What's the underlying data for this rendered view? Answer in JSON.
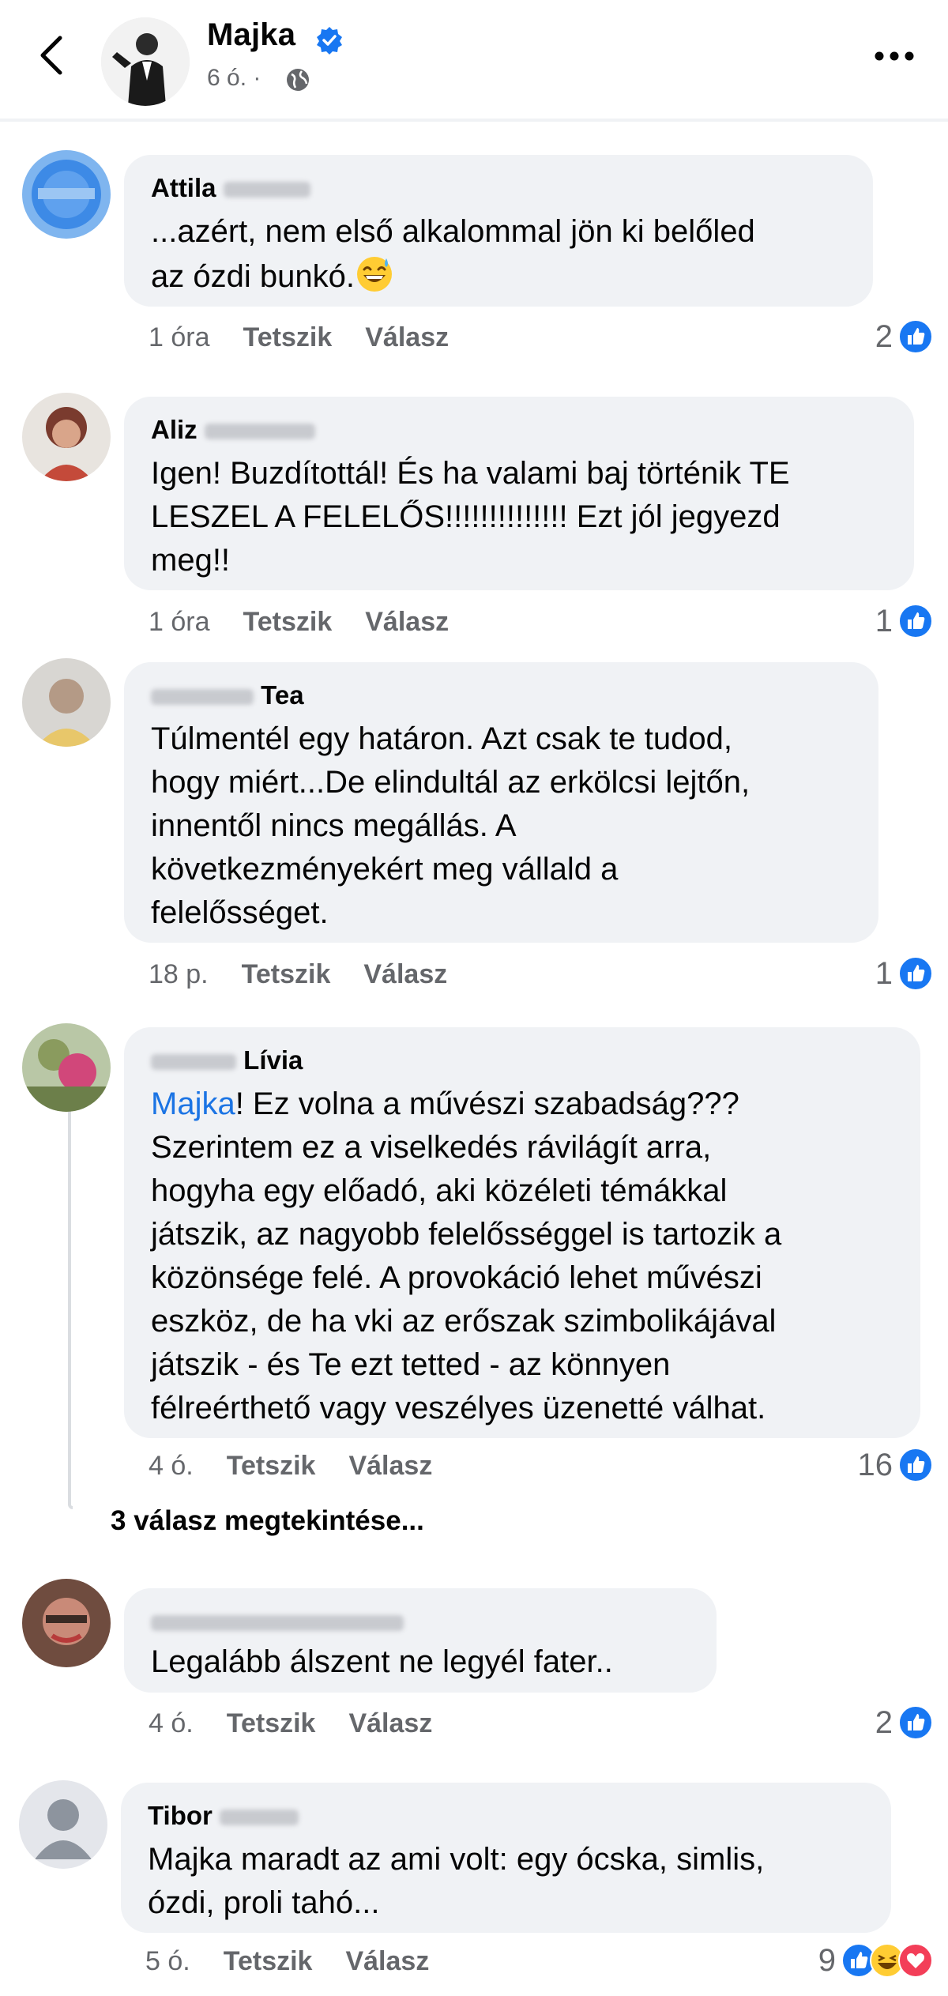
{
  "header": {
    "name": "Majka",
    "time": "6 ó. ·"
  },
  "comments": [
    {
      "author_visible": "Attila",
      "text": "...azért, nem első alkalommal jön ki belőled\naz ózdi bunkó.",
      "emoji": "sweat-smile-emoji",
      "time": "1 óra",
      "like_label": "Tetszik",
      "reply_label": "Válasz",
      "reactions": "2"
    },
    {
      "author_visible": "Aliz",
      "text": "Igen! Buzdítottál! És ha valami baj történik TE\nLESZEL A FELELŐS!!!!!!!!!!!!!! Ezt jól jegyezd\nmeg!!",
      "time": "1 óra",
      "like_label": "Tetszik",
      "reply_label": "Válasz",
      "reactions": "1"
    },
    {
      "author_visible": "Tea",
      "text": "Túlmentél egy határon. Azt csak te tudod,\nhogy miért...De elindultál az erkölcsi lejtőn,\ninnentől nincs megállás. A\nkövetkezményekért meg vállald a\nfelelősséget.",
      "time": "18 p.",
      "like_label": "Tetszik",
      "reply_label": "Válasz",
      "reactions": "1"
    },
    {
      "author_visible": "Lívia",
      "mention": "Majka",
      "text": "! Ez volna a művészi szabadság???\nSzerintem ez a viselkedés rávilágít arra,\nhogyha egy előadó, aki közéleti témákkal\njátszik, az nagyobb felelősséggel is tartozik a\nközönsége felé. A provokáció lehet művészi\neszköz, de ha vki az erőszak szimbolikájával\njátszik - és Te ezt tetted - az könnyen\nfélreérthető vagy veszélyes üzenetté válhat.",
      "time": "4 ó.",
      "like_label": "Tetszik",
      "reply_label": "Válasz",
      "reactions": "16",
      "view_replies": "3 válasz megtekintése..."
    },
    {
      "author_visible": "",
      "text": "Legalább álszent ne legyél fater..",
      "time": "4 ó.",
      "like_label": "Tetszik",
      "reply_label": "Válasz",
      "reactions": "2"
    },
    {
      "author_visible": "Tibor",
      "text": "Majka maradt az ami volt: egy ócska, simlis,\nózdi, proli tahó...",
      "time": "5 ó.",
      "like_label": "Tetszik",
      "reply_label": "Válasz",
      "reactions": "9"
    }
  ],
  "colors": {
    "accent": "#1b74e4",
    "like_blue": "#1877f2",
    "bubble": "#f0f2f5",
    "meta_gray": "#65676b"
  }
}
